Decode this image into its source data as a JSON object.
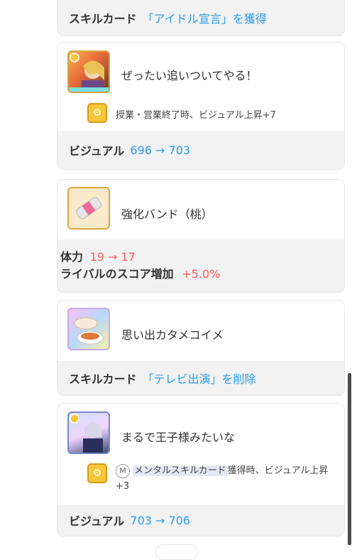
{
  "card1": {
    "label": "スキルカード",
    "value": "「アイドル宣言」を獲得"
  },
  "card2": {
    "title": "ぜったい追いついてやる！",
    "effect": "授業・営業終了時、ビジュアル上昇+7",
    "stat_label": "ビジュアル",
    "stat_change": "696 → 703"
  },
  "card3": {
    "title": "強化バンド（桃）",
    "stat1_label": "体力",
    "stat1_change": "19 → 17",
    "stat2_label": "ライバルのスコア増加",
    "stat2_change": "+5.0%"
  },
  "card4": {
    "title": "思い出カタメコイメ",
    "footer_label": "スキルカード",
    "footer_value": "「テレビ出演」を削除"
  },
  "card5": {
    "title": "まるで王子様みたいな",
    "chip": "M",
    "effect_highlight": "メンタルスキルカード",
    "effect_rest": "獲得時、ビジュアル上昇+3",
    "stat_label": "ビジュアル",
    "stat_change": "703 → 706"
  },
  "colors": {
    "accent_blue": "#2a9df0",
    "accent_red": "#ff5a5a",
    "footer_bg": "#f2f2f2",
    "skill_icon": "#f6c63a"
  }
}
